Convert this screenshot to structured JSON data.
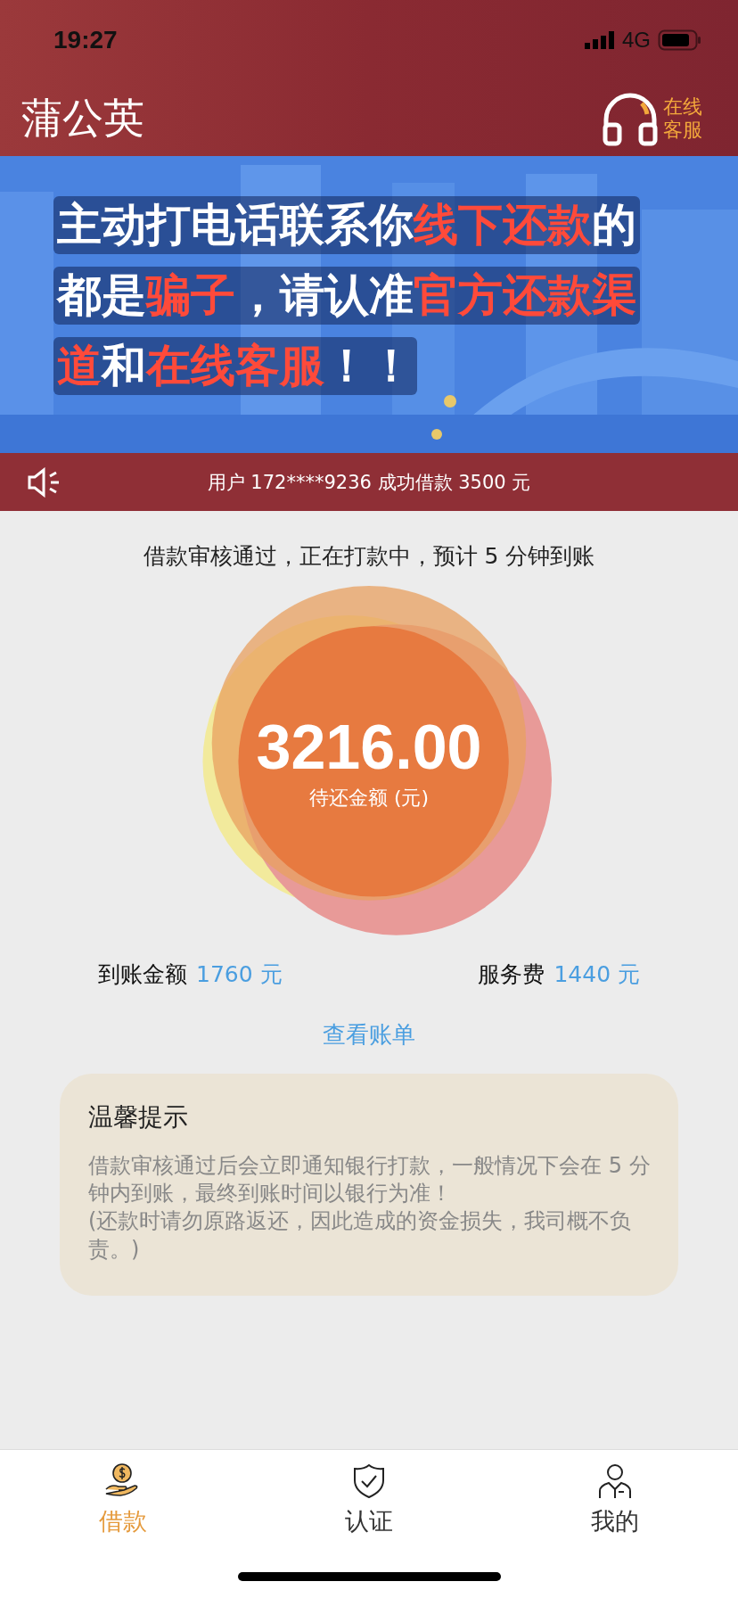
{
  "status_bar": {
    "time": "19:27",
    "network": "4G"
  },
  "header": {
    "title": "蒲公英",
    "support_label": "在线客服"
  },
  "banner": {
    "lines": [
      [
        {
          "text": "主动打电话联系你",
          "highlight": false
        },
        {
          "text": "线下还款",
          "highlight": true
        },
        {
          "text": "的",
          "highlight": false
        }
      ],
      [
        {
          "text": "都是",
          "highlight": false
        },
        {
          "text": "骗子",
          "highlight": true
        },
        {
          "text": "，请认准",
          "highlight": false
        },
        {
          "text": "官方还款渠",
          "highlight": true
        }
      ],
      [
        {
          "text": "道",
          "highlight": true
        },
        {
          "text": "和",
          "highlight": false
        },
        {
          "text": "在线客服",
          "highlight": true
        },
        {
          "text": "！！",
          "highlight": false
        }
      ]
    ]
  },
  "ticker": {
    "text": "用户 172****9236 成功借款 3500 元"
  },
  "loan": {
    "status": "借款审核通过，正在打款中，预计 5 分钟到账",
    "amount": "3216.00",
    "amount_label": "待还金额 (元)",
    "stats": [
      {
        "label": "到账金额",
        "value": "1760 元"
      },
      {
        "label": "服务费",
        "value": "1440 元"
      }
    ],
    "bill_link": "查看账单"
  },
  "notice": {
    "title": "温馨提示",
    "body": [
      "借款审核通过后会立即通知银行打款，一般情况下会在 5 分钟内到账，最终到账时间以银行为准！",
      "(还款时请勿原路返还，因此造成的资金损失，我司概不负责。)"
    ]
  },
  "tabs": [
    {
      "label": "借款",
      "kind": "money",
      "selected": true
    },
    {
      "label": "认证",
      "kind": "shield",
      "selected": false
    },
    {
      "label": "我的",
      "kind": "person",
      "selected": false
    }
  ]
}
